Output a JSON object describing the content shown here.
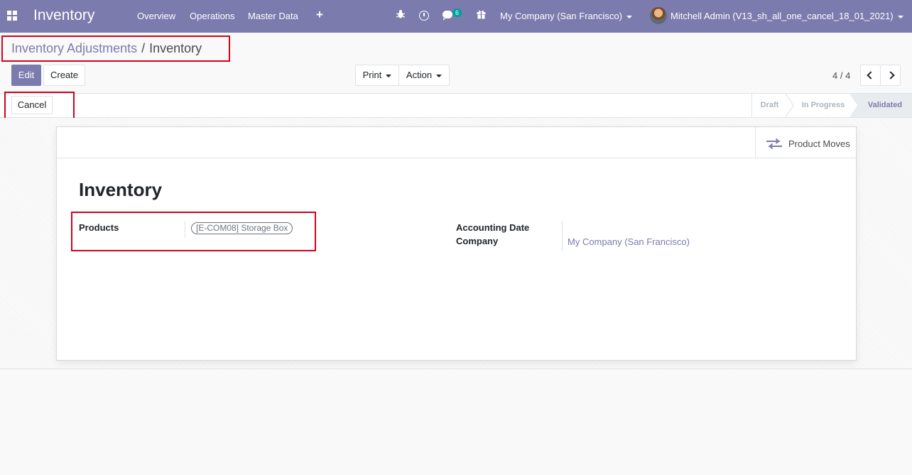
{
  "navbar": {
    "app_name": "Inventory",
    "menus": [
      "Overview",
      "Operations",
      "Master Data"
    ],
    "plus_label": "+",
    "message_count": "6",
    "company": "My Company (San Francisco)",
    "user": "Mitchell Admin (V13_sh_all_one_cancel_18_01_2021)",
    "accent": "#7c7bad"
  },
  "breadcrumb": {
    "parent": "Inventory Adjustments",
    "separator": "/",
    "current": "Inventory"
  },
  "buttons": {
    "edit": "Edit",
    "create": "Create",
    "print": "Print",
    "action": "Action",
    "cancel": "Cancel"
  },
  "pager": {
    "value": "4 / 4"
  },
  "statusbar": {
    "stages": [
      "Draft",
      "In Progress",
      "Validated"
    ],
    "active": "Validated"
  },
  "sheet": {
    "smart_button": "Product Moves",
    "title": "Inventory",
    "fields": {
      "products_label": "Products",
      "products_tag": "[E-COM08] Storage Box",
      "accounting_date_label": "Accounting Date",
      "company_label": "Company",
      "company_value": "My Company (San Francisco)"
    }
  },
  "highlight_color": "#d0021b"
}
